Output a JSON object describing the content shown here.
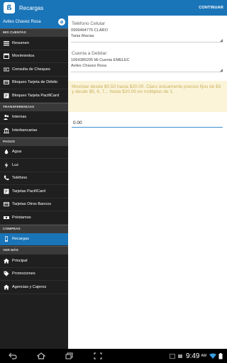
{
  "app": {
    "title": "Recargas",
    "continue_label": "CONTINUAR",
    "logo_glyph": "ß"
  },
  "sidebar": {
    "user_name": "Aviles Chavez Rosa",
    "user_badge": "⊘",
    "sections": {
      "mis_cuentas": "MIS CUENTAS",
      "transferencias": "TRANSFERENCIAS",
      "pagos": "PAGOS",
      "compras": "COMPRAS",
      "ver_mas": "VER MÁS"
    },
    "items": {
      "resumen": "Resumen",
      "movimientos": "Movimientos",
      "consulta_cheques": "Consulta de Cheques",
      "bloqueo_debito": "Bloqueo Tarjeta de Débito",
      "bloqueo_pacificard": "Bloqueo Tarjeta PacifiCard",
      "internas": "Internas",
      "interbancarias": "Interbancarias",
      "agua": "Agua",
      "luz": "Luz",
      "telefono": "Teléfono",
      "tarjetas_pacificard": "Tarjetas PacifiCard",
      "tarjetas_otros": "Tarjetas Otros Bancos",
      "prestamos": "Préstamos",
      "recargas": "Recargas",
      "principal": "Principal",
      "promociones": "Promociones",
      "agencias": "Agencias y Cajeros"
    }
  },
  "main": {
    "phone_label": "Teléfono Celular",
    "phone_number": "0999494775 CLARO",
    "phone_name": "Tania Macias",
    "debit_label": "Cuenta a Debitar:",
    "debit_account": "1064385205 Mi Cuenta EMELEC",
    "debit_name": "Aviles Chavez Rosa",
    "info_text": "Movistar desde $0.50 hasta $20.00. Claro únicamente precios fijos de $3 y desde $5, 6, 7... hasta $20.00 en múltiplos de 1.",
    "amount_value": "0.00"
  },
  "status": {
    "time": "9:49",
    "ampm": "AM"
  },
  "colors": {
    "accent": "#1a74b8",
    "sidebar_bg": "#1f1f1f",
    "info_bg": "#fbf4d9"
  }
}
